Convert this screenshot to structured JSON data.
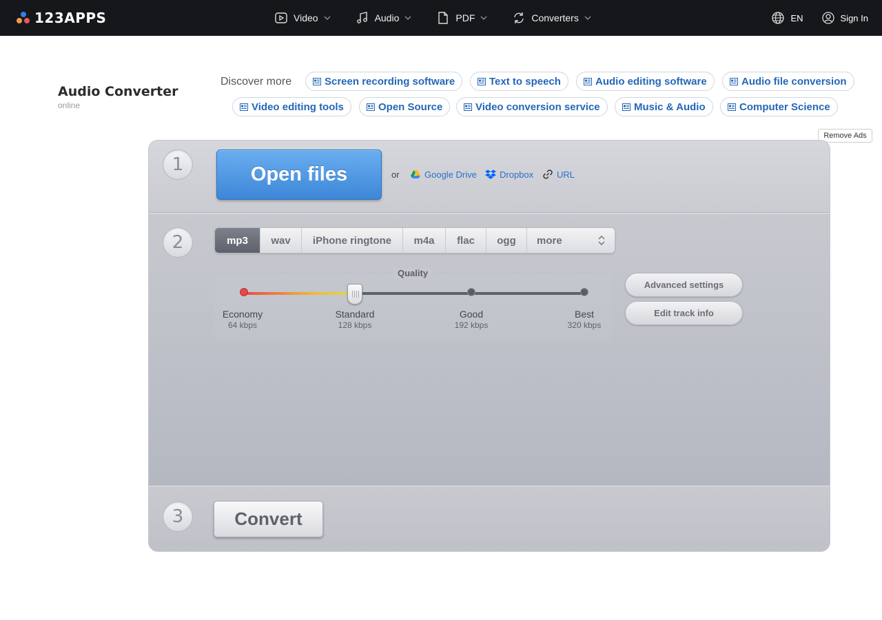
{
  "brand": {
    "logo_text": "123APPS"
  },
  "nav": {
    "items": [
      {
        "label": "Video",
        "icon": "video-icon"
      },
      {
        "label": "Audio",
        "icon": "music-note-icon"
      },
      {
        "label": "PDF",
        "icon": "document-icon"
      },
      {
        "label": "Converters",
        "icon": "convert-icon"
      }
    ],
    "language": "EN",
    "sign_in": "Sign In"
  },
  "page": {
    "title": "Audio Converter",
    "subtitle": "online"
  },
  "discover": {
    "label": "Discover more",
    "chips": [
      "Screen recording software",
      "Text to speech",
      "Audio editing software",
      "Audio file conversion",
      "Video editing tools",
      "Open Source",
      "Video conversion service",
      "Music & Audio",
      "Computer Science"
    ]
  },
  "remove_ads": "Remove Ads",
  "step1": {
    "number": "1",
    "open_files": "Open files",
    "or": "or",
    "sources": [
      "Google Drive",
      "Dropbox",
      "URL"
    ]
  },
  "step2": {
    "number": "2",
    "formats": [
      "mp3",
      "wav",
      "iPhone ringtone",
      "m4a",
      "flac",
      "ogg"
    ],
    "more": "more",
    "selected_format": "mp3",
    "quality": {
      "label": "Quality",
      "levels": [
        {
          "name": "Economy",
          "rate": "64 kbps"
        },
        {
          "name": "Standard",
          "rate": "128 kbps"
        },
        {
          "name": "Good",
          "rate": "192 kbps"
        },
        {
          "name": "Best",
          "rate": "320 kbps"
        }
      ],
      "selected_index": 1
    },
    "advanced_settings": "Advanced settings",
    "edit_track_info": "Edit track info"
  },
  "step3": {
    "number": "3",
    "convert": "Convert"
  },
  "colors": {
    "link": "#2467b8",
    "open_button": "#4a94e0",
    "topbar": "#16171b"
  }
}
